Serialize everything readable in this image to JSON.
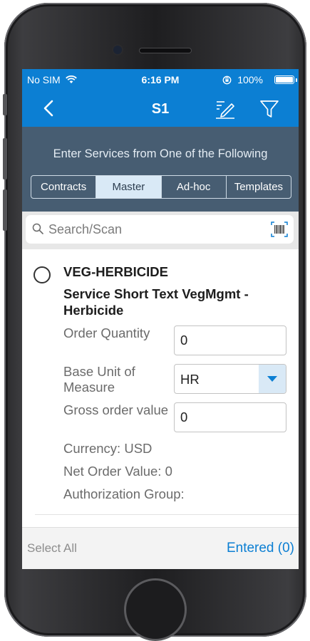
{
  "status_bar": {
    "carrier": "No SIM",
    "time": "6:16 PM",
    "battery": "100%",
    "battery_level": 1.0
  },
  "nav": {
    "title": "S1",
    "icons": [
      "back-chevron-icon",
      "edit-pen-icon",
      "filter-funnel-icon"
    ]
  },
  "source": {
    "heading": "Enter Services from One of the Following",
    "tabs": [
      {
        "label": "Contracts",
        "active": false
      },
      {
        "label": "Master",
        "active": true
      },
      {
        "label": "Ad-hoc",
        "active": false
      },
      {
        "label": "Templates",
        "active": false
      }
    ]
  },
  "search": {
    "placeholder": "Search/Scan",
    "value": "",
    "icons": [
      "search-icon",
      "barcode-icon"
    ]
  },
  "item": {
    "code": "VEG-HERBICIDE",
    "description": "Service Short Text VegMgmt - Herbicide",
    "order_quantity": {
      "label": "Order Quantity",
      "value": "0"
    },
    "base_unit": {
      "label": "Base Unit of Measure",
      "value": "HR"
    },
    "gross_order_value": {
      "label": "Gross order value",
      "value": "0"
    },
    "currency": "Currency: USD",
    "net_order_value": "Net Order Value: 0",
    "authorization_group": "Authorization Group:"
  },
  "footer": {
    "select_all": "Select All",
    "entered": "Entered (0)"
  },
  "colors": {
    "primary_blue": "#0c7fd3",
    "source_bar": "#475d72",
    "active_tab": "#d9e9f6"
  }
}
